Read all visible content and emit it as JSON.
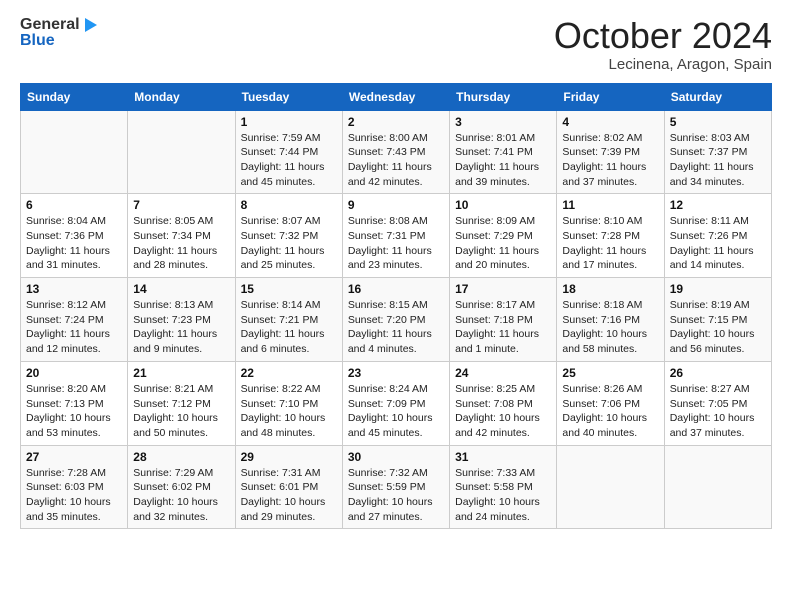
{
  "header": {
    "logo_general": "General",
    "logo_blue": "Blue",
    "month_title": "October 2024",
    "location": "Lecinena, Aragon, Spain"
  },
  "weekdays": [
    "Sunday",
    "Monday",
    "Tuesday",
    "Wednesday",
    "Thursday",
    "Friday",
    "Saturday"
  ],
  "weeks": [
    [
      {
        "day": "",
        "info": ""
      },
      {
        "day": "",
        "info": ""
      },
      {
        "day": "1",
        "info": "Sunrise: 7:59 AM\nSunset: 7:44 PM\nDaylight: 11 hours and 45 minutes."
      },
      {
        "day": "2",
        "info": "Sunrise: 8:00 AM\nSunset: 7:43 PM\nDaylight: 11 hours and 42 minutes."
      },
      {
        "day": "3",
        "info": "Sunrise: 8:01 AM\nSunset: 7:41 PM\nDaylight: 11 hours and 39 minutes."
      },
      {
        "day": "4",
        "info": "Sunrise: 8:02 AM\nSunset: 7:39 PM\nDaylight: 11 hours and 37 minutes."
      },
      {
        "day": "5",
        "info": "Sunrise: 8:03 AM\nSunset: 7:37 PM\nDaylight: 11 hours and 34 minutes."
      }
    ],
    [
      {
        "day": "6",
        "info": "Sunrise: 8:04 AM\nSunset: 7:36 PM\nDaylight: 11 hours and 31 minutes."
      },
      {
        "day": "7",
        "info": "Sunrise: 8:05 AM\nSunset: 7:34 PM\nDaylight: 11 hours and 28 minutes."
      },
      {
        "day": "8",
        "info": "Sunrise: 8:07 AM\nSunset: 7:32 PM\nDaylight: 11 hours and 25 minutes."
      },
      {
        "day": "9",
        "info": "Sunrise: 8:08 AM\nSunset: 7:31 PM\nDaylight: 11 hours and 23 minutes."
      },
      {
        "day": "10",
        "info": "Sunrise: 8:09 AM\nSunset: 7:29 PM\nDaylight: 11 hours and 20 minutes."
      },
      {
        "day": "11",
        "info": "Sunrise: 8:10 AM\nSunset: 7:28 PM\nDaylight: 11 hours and 17 minutes."
      },
      {
        "day": "12",
        "info": "Sunrise: 8:11 AM\nSunset: 7:26 PM\nDaylight: 11 hours and 14 minutes."
      }
    ],
    [
      {
        "day": "13",
        "info": "Sunrise: 8:12 AM\nSunset: 7:24 PM\nDaylight: 11 hours and 12 minutes."
      },
      {
        "day": "14",
        "info": "Sunrise: 8:13 AM\nSunset: 7:23 PM\nDaylight: 11 hours and 9 minutes."
      },
      {
        "day": "15",
        "info": "Sunrise: 8:14 AM\nSunset: 7:21 PM\nDaylight: 11 hours and 6 minutes."
      },
      {
        "day": "16",
        "info": "Sunrise: 8:15 AM\nSunset: 7:20 PM\nDaylight: 11 hours and 4 minutes."
      },
      {
        "day": "17",
        "info": "Sunrise: 8:17 AM\nSunset: 7:18 PM\nDaylight: 11 hours and 1 minute."
      },
      {
        "day": "18",
        "info": "Sunrise: 8:18 AM\nSunset: 7:16 PM\nDaylight: 10 hours and 58 minutes."
      },
      {
        "day": "19",
        "info": "Sunrise: 8:19 AM\nSunset: 7:15 PM\nDaylight: 10 hours and 56 minutes."
      }
    ],
    [
      {
        "day": "20",
        "info": "Sunrise: 8:20 AM\nSunset: 7:13 PM\nDaylight: 10 hours and 53 minutes."
      },
      {
        "day": "21",
        "info": "Sunrise: 8:21 AM\nSunset: 7:12 PM\nDaylight: 10 hours and 50 minutes."
      },
      {
        "day": "22",
        "info": "Sunrise: 8:22 AM\nSunset: 7:10 PM\nDaylight: 10 hours and 48 minutes."
      },
      {
        "day": "23",
        "info": "Sunrise: 8:24 AM\nSunset: 7:09 PM\nDaylight: 10 hours and 45 minutes."
      },
      {
        "day": "24",
        "info": "Sunrise: 8:25 AM\nSunset: 7:08 PM\nDaylight: 10 hours and 42 minutes."
      },
      {
        "day": "25",
        "info": "Sunrise: 8:26 AM\nSunset: 7:06 PM\nDaylight: 10 hours and 40 minutes."
      },
      {
        "day": "26",
        "info": "Sunrise: 8:27 AM\nSunset: 7:05 PM\nDaylight: 10 hours and 37 minutes."
      }
    ],
    [
      {
        "day": "27",
        "info": "Sunrise: 7:28 AM\nSunset: 6:03 PM\nDaylight: 10 hours and 35 minutes."
      },
      {
        "day": "28",
        "info": "Sunrise: 7:29 AM\nSunset: 6:02 PM\nDaylight: 10 hours and 32 minutes."
      },
      {
        "day": "29",
        "info": "Sunrise: 7:31 AM\nSunset: 6:01 PM\nDaylight: 10 hours and 29 minutes."
      },
      {
        "day": "30",
        "info": "Sunrise: 7:32 AM\nSunset: 5:59 PM\nDaylight: 10 hours and 27 minutes."
      },
      {
        "day": "31",
        "info": "Sunrise: 7:33 AM\nSunset: 5:58 PM\nDaylight: 10 hours and 24 minutes."
      },
      {
        "day": "",
        "info": ""
      },
      {
        "day": "",
        "info": ""
      }
    ]
  ]
}
